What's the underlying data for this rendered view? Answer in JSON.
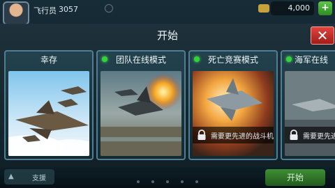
{
  "hud": {
    "pilot_label": "飞行员",
    "pilot_value": "3057",
    "currency_value": "4,000",
    "add_label": "+"
  },
  "modal": {
    "title": "开始",
    "close_label": "✕",
    "cards": [
      {
        "title": "幸存",
        "online": false,
        "locked": false
      },
      {
        "title": "团队在线模式",
        "online": true,
        "locked": false
      },
      {
        "title": "死亡竞赛模式",
        "online": true,
        "locked": true,
        "lock_text": "需要更先进的战斗机"
      },
      {
        "title": "海军在线",
        "online": true,
        "locked": true,
        "lock_text": "需要更先进"
      }
    ]
  },
  "bottom": {
    "support_label": "支援",
    "start_label": "开始"
  },
  "colors": {
    "accent_green": "#35d23a",
    "close_red": "#e1443c",
    "card_border": "#4f7f95"
  }
}
